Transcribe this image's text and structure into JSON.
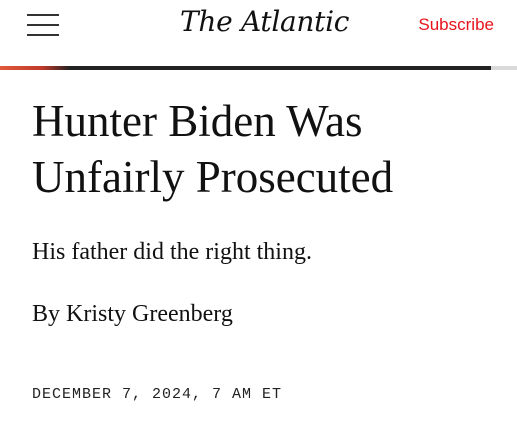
{
  "header": {
    "logo_text": "The Atlantic",
    "subscribe_label": "Subscribe",
    "menu_icon": "hamburger-menu-icon",
    "read_progress": 0.95,
    "accent_color": "#e7131a"
  },
  "article": {
    "headline": "Hunter Biden Was Unfairly Prosecuted",
    "dek": "His father did the right thing.",
    "byline_prefix": "By ",
    "author": "Kristy Greenberg",
    "dateline": "DECEMBER 7, 2024, 7 AM ET"
  }
}
